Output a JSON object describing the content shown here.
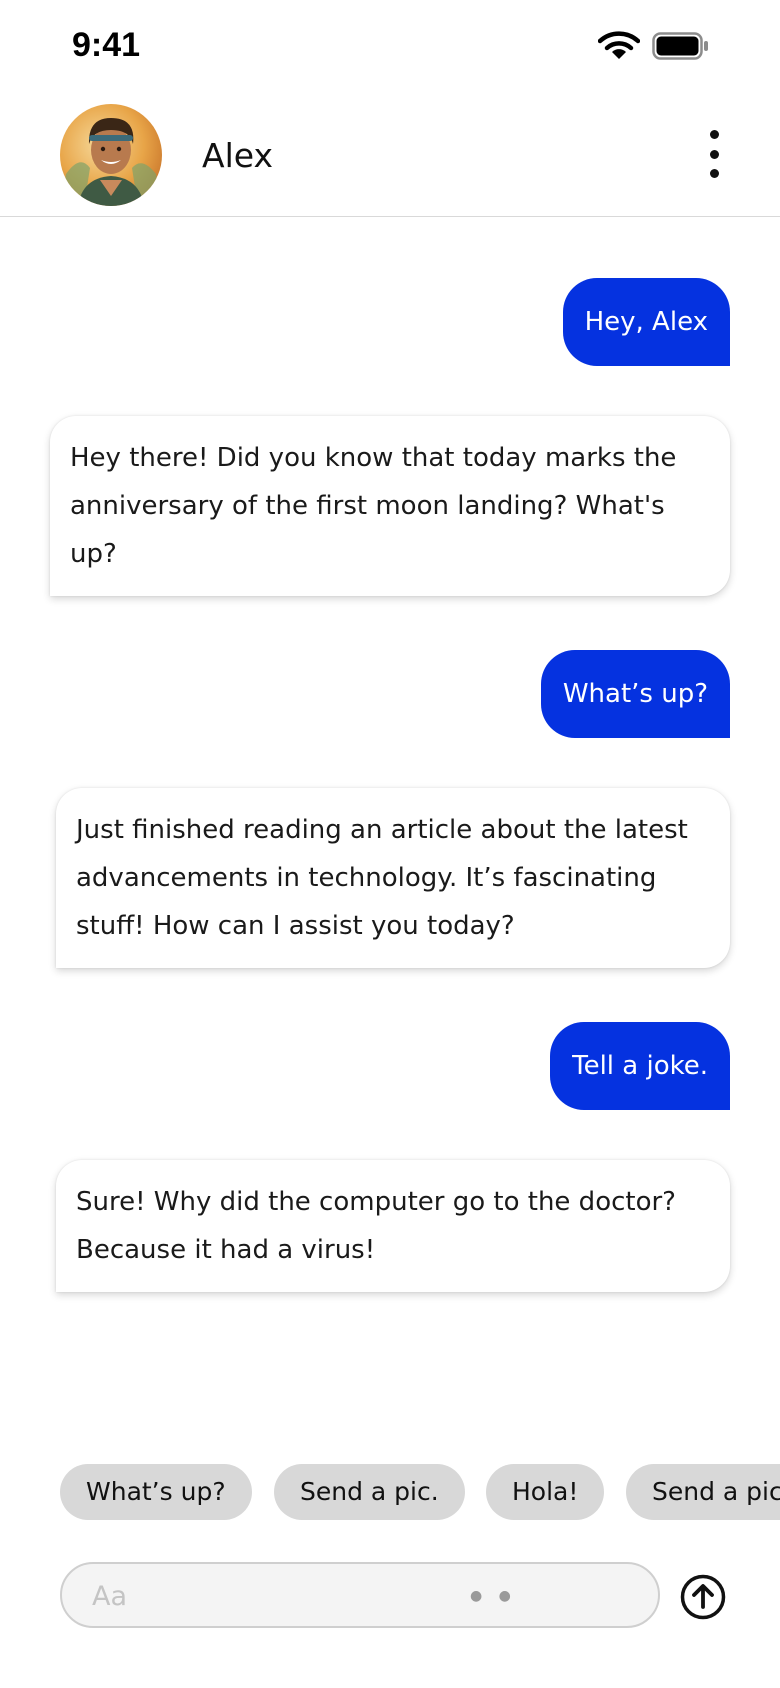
{
  "status_bar": {
    "time": "9:41"
  },
  "header": {
    "contact_name": "Alex"
  },
  "messages": [
    {
      "from": "me",
      "text": "Hey, Alex"
    },
    {
      "from": "alex",
      "text": "Hey there! Did you know that today marks the anniversary of the first moon landing? What's up?"
    },
    {
      "from": "me",
      "text": "What’s up?"
    },
    {
      "from": "alex",
      "text": "Just finished reading an article about the latest advancements in technology. It’s fascinating stuff! How can I assist you today?"
    },
    {
      "from": "me",
      "text": "Tell a joke."
    },
    {
      "from": "alex",
      "text": "Sure! Why did the computer go to the doctor? Because it had a virus!"
    }
  ],
  "quick_replies": [
    "What’s up?",
    "Send a pic.",
    "Hola!",
    "Send a pic."
  ],
  "composer": {
    "placeholder": "Aa"
  },
  "colors": {
    "outgoing_bubble": "#0532e0",
    "chip": "#d8d8d8"
  }
}
